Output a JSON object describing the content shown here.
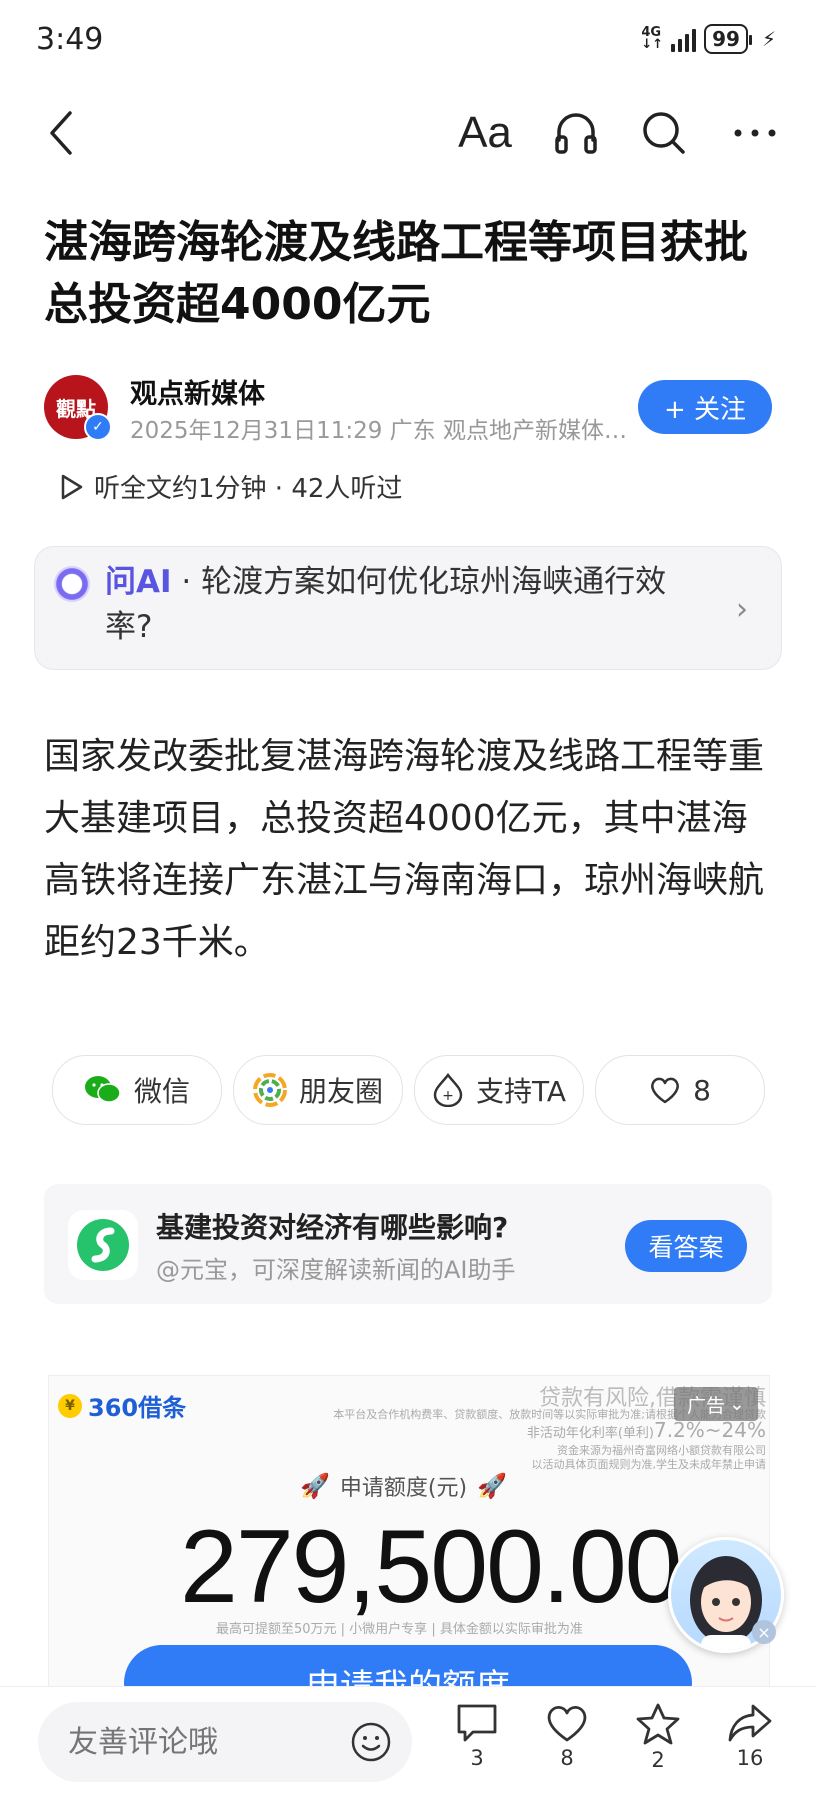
{
  "status_bar": {
    "time": "3:49",
    "network": "4G",
    "battery": "99"
  },
  "nav": {
    "font_size_label": "Aa"
  },
  "article": {
    "title": "湛海跨海轮渡及线路工程等项目获批 总投资超4000亿元",
    "author": {
      "name": "观点新媒体",
      "avatar_text": "觀點",
      "meta": "2025年12月31日11:29 广东 观点地产新媒体…",
      "follow_label": "+ 关注"
    },
    "listen": "听全文约1分钟 · 42人听过",
    "ask_ai": {
      "label": "问AI",
      "question": " · 轮渡方案如何优化琼州海峡通行效率?"
    },
    "summary": "国家发改委批复湛海跨海轮渡及线路工程等重大基建项目，总投资超4000亿元，其中湛海高铁将连接广东湛江与海南海口，琼州海峡航距约23千米。"
  },
  "share": {
    "wechat": "微信",
    "moments": "朋友圈",
    "support": "支持TA",
    "likes": "8"
  },
  "yuanbao": {
    "question": "基建投资对经济有哪些影响?",
    "subtitle": "@元宝，可深度解读新闻的AI助手",
    "button": "看答案"
  },
  "ad": {
    "brand": "360借条",
    "coin": "¥",
    "risk": "贷款有风险,借款需谨慎",
    "tag": "广告",
    "disclaimer1": "本平台及合作机构费率、贷款额度、放款时间等以实际审批为准;请根据个人能力合理贷款",
    "rate_label": "非活动年化利率(单利)",
    "rate_value": "7.2%~24%",
    "disclaimer2": "资金来源为福州奇富网络小额贷款有限公司",
    "disclaimer3": "以活动具体页面规则为准,学生及未成年禁止申请",
    "amount_label": "申请额度(元)",
    "amount": "279,500.00",
    "limit_note": "最高可提额至50万元 | 小微用户专享 | 具体金额以实际审批为准",
    "cta": "申请我的额度"
  },
  "bottom_bar": {
    "comment_placeholder": "友善评论哦",
    "comments": "3",
    "likes": "8",
    "favorites": "2",
    "shares": "16"
  }
}
